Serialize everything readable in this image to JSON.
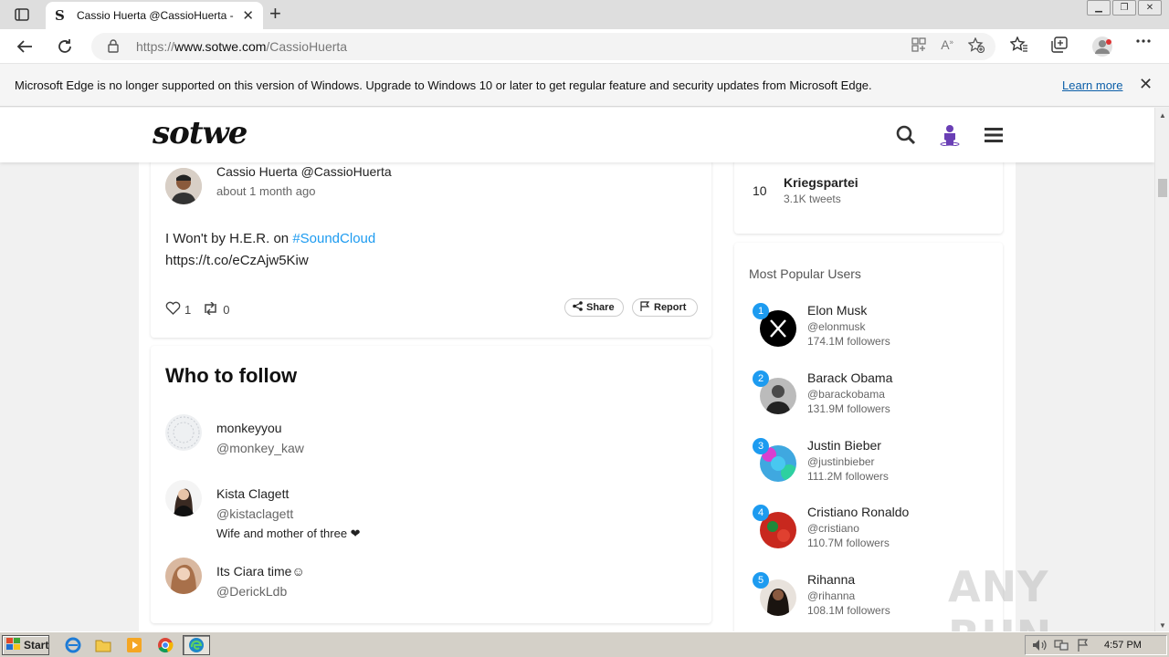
{
  "browser": {
    "tab_title": "Cassio Huerta @CassioHuerta - T",
    "url_prefix": "https://",
    "url_domain": "www.sotwe.com",
    "url_path": "/CassioHuerta"
  },
  "infobar": {
    "message": "Microsoft Edge is no longer supported on this version of Windows. Upgrade to Windows 10 or later to get regular feature and security updates from Microsoft Edge.",
    "link": "Learn more"
  },
  "site": {
    "logo": "sotwe"
  },
  "tweet": {
    "author": "Cassio Huerta @CassioHuerta",
    "time": "about 1 month ago",
    "text_prefix": "I Won't by H.E.R. on ",
    "hashtag": "#SoundCloud",
    "link": "https://t.co/eCzAjw5Kiw",
    "likes": "1",
    "retweets": "0",
    "share_label": "Share",
    "report_label": "Report"
  },
  "who_to_follow": {
    "title": "Who to follow",
    "users": [
      {
        "name": "monkeyyou",
        "handle": "@monkey_kaw",
        "bio": ""
      },
      {
        "name": "Kista Clagett",
        "handle": "@kistaclagett",
        "bio": "Wife and mother of three ❤"
      },
      {
        "name": "Its Ciara time☺",
        "handle": "@DerickLdb",
        "bio": ""
      }
    ]
  },
  "trending": {
    "rank": "10",
    "name": "Kriegspartei",
    "count": "3.1K tweets"
  },
  "popular": {
    "title": "Most Popular Users",
    "users": [
      {
        "rank": "1",
        "name": "Elon Musk",
        "handle": "@elonmusk",
        "followers": "174.1M followers"
      },
      {
        "rank": "2",
        "name": "Barack Obama",
        "handle": "@barackobama",
        "followers": "131.9M followers"
      },
      {
        "rank": "3",
        "name": "Justin Bieber",
        "handle": "@justinbieber",
        "followers": "111.2M followers"
      },
      {
        "rank": "4",
        "name": "Cristiano Ronaldo",
        "handle": "@cristiano",
        "followers": "110.7M followers"
      },
      {
        "rank": "5",
        "name": "Rihanna",
        "handle": "@rihanna",
        "followers": "108.1M followers"
      }
    ]
  },
  "watermark": "ANY RUN",
  "taskbar": {
    "start_label": "Start",
    "clock": "4:57 PM"
  },
  "colors": {
    "accent": "#1d9bf0",
    "link": "#0b5ea8",
    "avatar_purple": "#6a3fb5"
  }
}
